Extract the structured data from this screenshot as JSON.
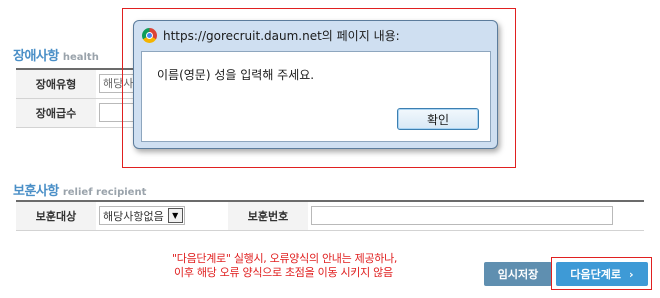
{
  "health_section": {
    "title": "장애사항",
    "subtitle": "health",
    "rows": [
      {
        "label": "장애유형",
        "value": "해당사"
      },
      {
        "label": "장애급수",
        "value": ""
      }
    ]
  },
  "relief_section": {
    "title": "보훈사항",
    "subtitle": "relief recipient",
    "type_label": "보훈대상",
    "type_value": "해당사항없음",
    "number_label": "보훈번호",
    "number_value": ""
  },
  "note": {
    "line1": "\"다음단계로\" 실행시, 오류양식의 안내는 제공하나,",
    "line2": "이후 해당 오류 양식으로 초점을 이동 시키지 않음"
  },
  "buttons": {
    "temp_save": "임시저장",
    "next_step": "다음단계로",
    "next_chevron": "›"
  },
  "dialog": {
    "title": "https://gorecruit.daum.net의 페이지 내용:",
    "message": "이름(영문) 성을 입력해 주세요.",
    "ok_label": "확인"
  },
  "colors": {
    "section_title": "#4a8fc7",
    "annotation_red": "#e02020",
    "next_button": "#3e9ad6",
    "temp_button": "#5f8fb0"
  }
}
